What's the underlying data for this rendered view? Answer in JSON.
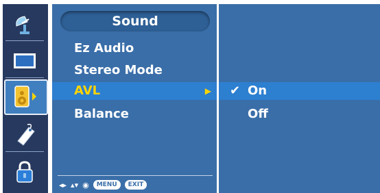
{
  "menu": {
    "title": "Sound",
    "items": [
      {
        "label": "Ez Audio"
      },
      {
        "label": "Stereo Mode"
      },
      {
        "label": "AVL"
      },
      {
        "label": "Balance"
      }
    ],
    "selected_index": 2,
    "selected_arrow": "▶"
  },
  "sidebar": {
    "items": [
      {
        "icon": "satellite-dish-icon"
      },
      {
        "icon": "screen-icon"
      },
      {
        "icon": "speaker-icon"
      },
      {
        "icon": "tag-icon"
      },
      {
        "icon": "lock-icon"
      }
    ],
    "selected_index": 2
  },
  "submenu": {
    "options": [
      {
        "label": "On",
        "check": "✔"
      },
      {
        "label": "Off"
      }
    ],
    "selected_index": 0
  },
  "footer": {
    "nav_arrows": "◂▸",
    "updown_arrows": "▴▾",
    "ok_symbol": "◉",
    "menu_label": "MENU",
    "exit_label": "EXIT"
  },
  "colors": {
    "panel": "#3a6ea8",
    "highlight": "#2d7fd0",
    "selected_text": "#ffd400",
    "sidebar": "#27395e"
  }
}
